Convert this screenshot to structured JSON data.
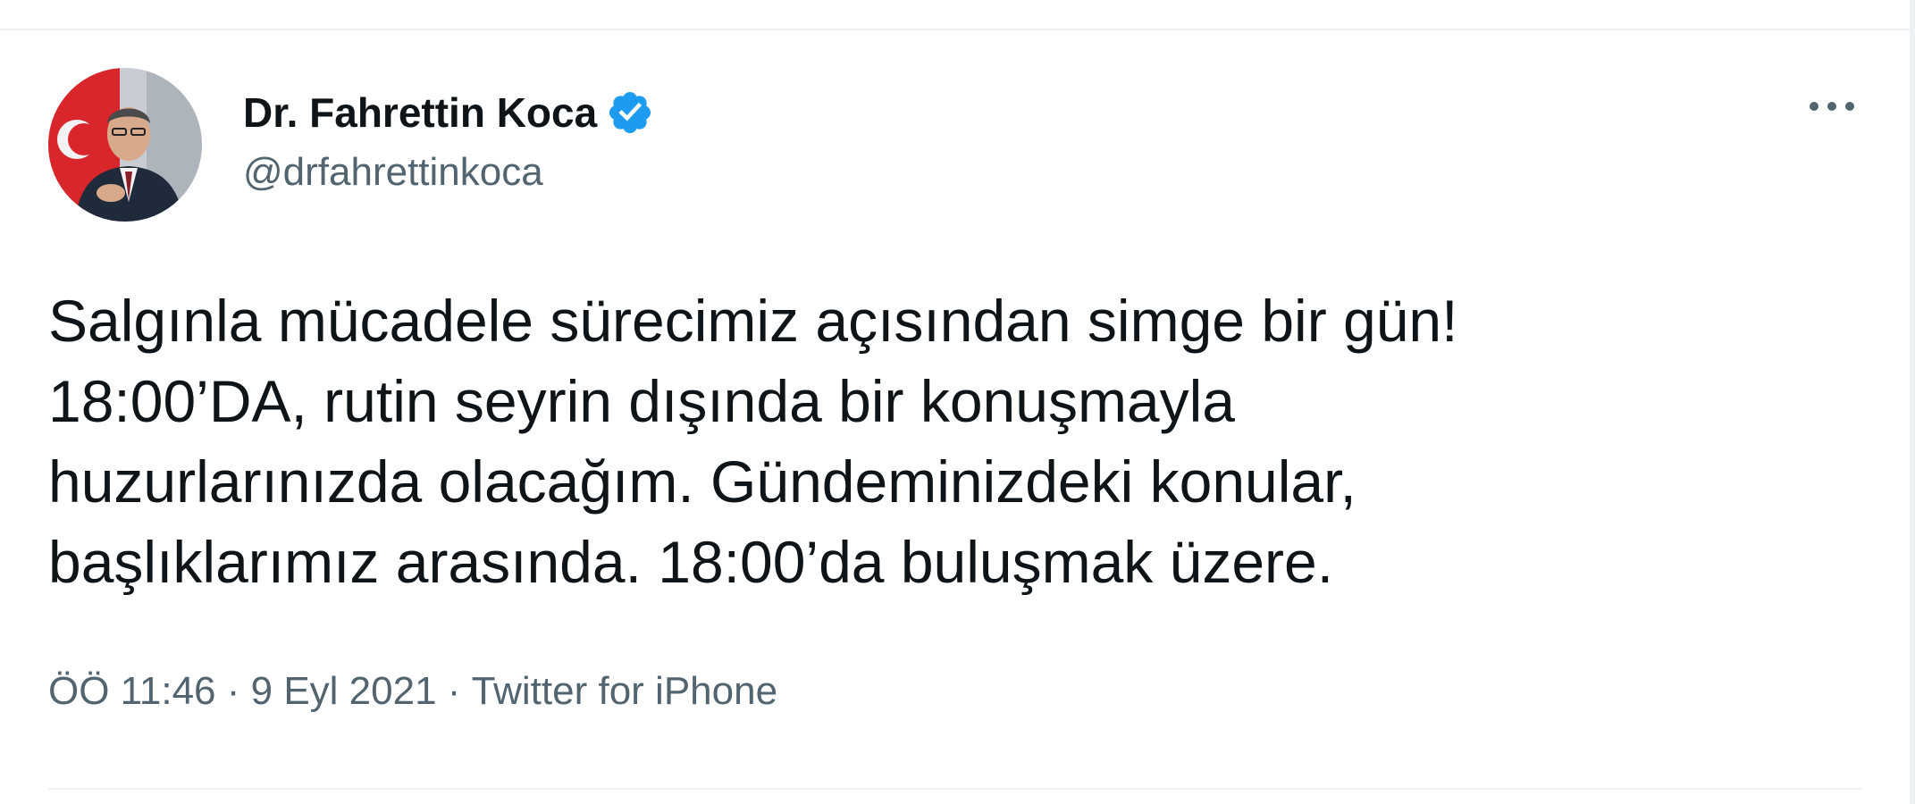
{
  "tweet": {
    "author": {
      "display_name": "Dr. Fahrettin Koca",
      "handle": "@drfahrettinkoca",
      "verified_icon": "verified-badge-icon",
      "avatar_icon": "profile-photo"
    },
    "more_icon": "more-options-icon",
    "text": "Salgınla mücadele sürecimiz açısından simge bir gün!\n18:00’DA, rutin seyrin dışında bir konuşmayla\nhuzurlarınızda olacağım. Gündeminizdeki konular,\nbaşlıklarımız arasında. 18:00’da buluşmak üzere.",
    "time": "ÖÖ 11:46",
    "date": "9 Eyl 2021",
    "separator": " · ",
    "source": "Twitter for iPhone"
  },
  "colors": {
    "primary_text": "#0f1419",
    "secondary_text": "#536471",
    "verified_blue": "#1d9bf0",
    "divider": "#eff3f4"
  }
}
